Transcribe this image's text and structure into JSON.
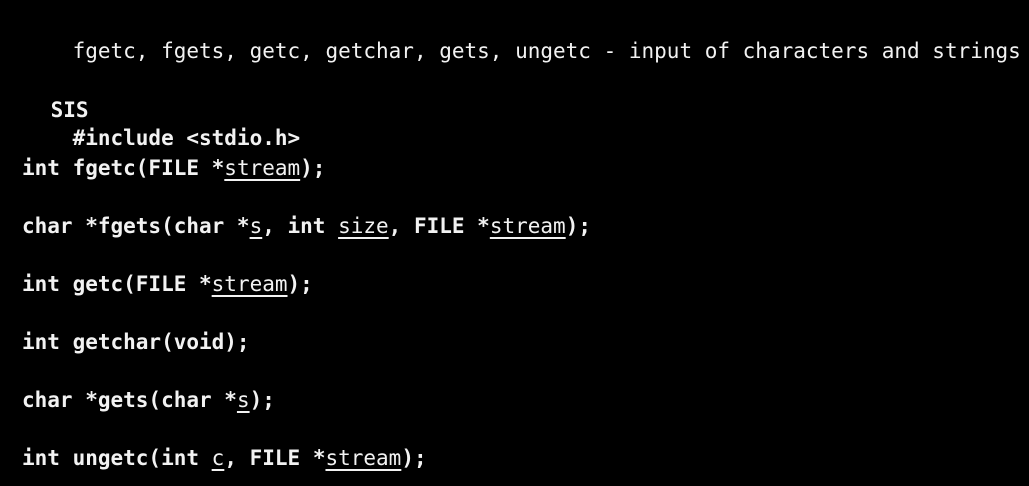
{
  "name_section": {
    "description": "fgetc, fgets, getc, getchar, gets, ungetc - input of characters and strings"
  },
  "synopsis": {
    "heading": "SIS",
    "include": "#include <stdio.h>",
    "fgetc": {
      "pre": "int fgetc(FILE *",
      "param": "stream",
      "post": ");"
    },
    "fgets": {
      "pre": "char *fgets(char *",
      "p1": "s",
      "mid1": ", int ",
      "p2": "size",
      "mid2": ", FILE *",
      "p3": "stream",
      "post": ");"
    },
    "getc": {
      "pre": "int getc(FILE *",
      "param": "stream",
      "post": ");"
    },
    "getchar": {
      "text": "int getchar(void);"
    },
    "gets": {
      "pre": "char *gets(char *",
      "param": "s",
      "post": ");"
    },
    "ungetc": {
      "pre": "int ungetc(int ",
      "p1": "c",
      "mid": ", FILE *",
      "p2": "stream",
      "post": ");"
    }
  },
  "colors": {
    "background": "#000000",
    "text": "#f2f2f2"
  }
}
